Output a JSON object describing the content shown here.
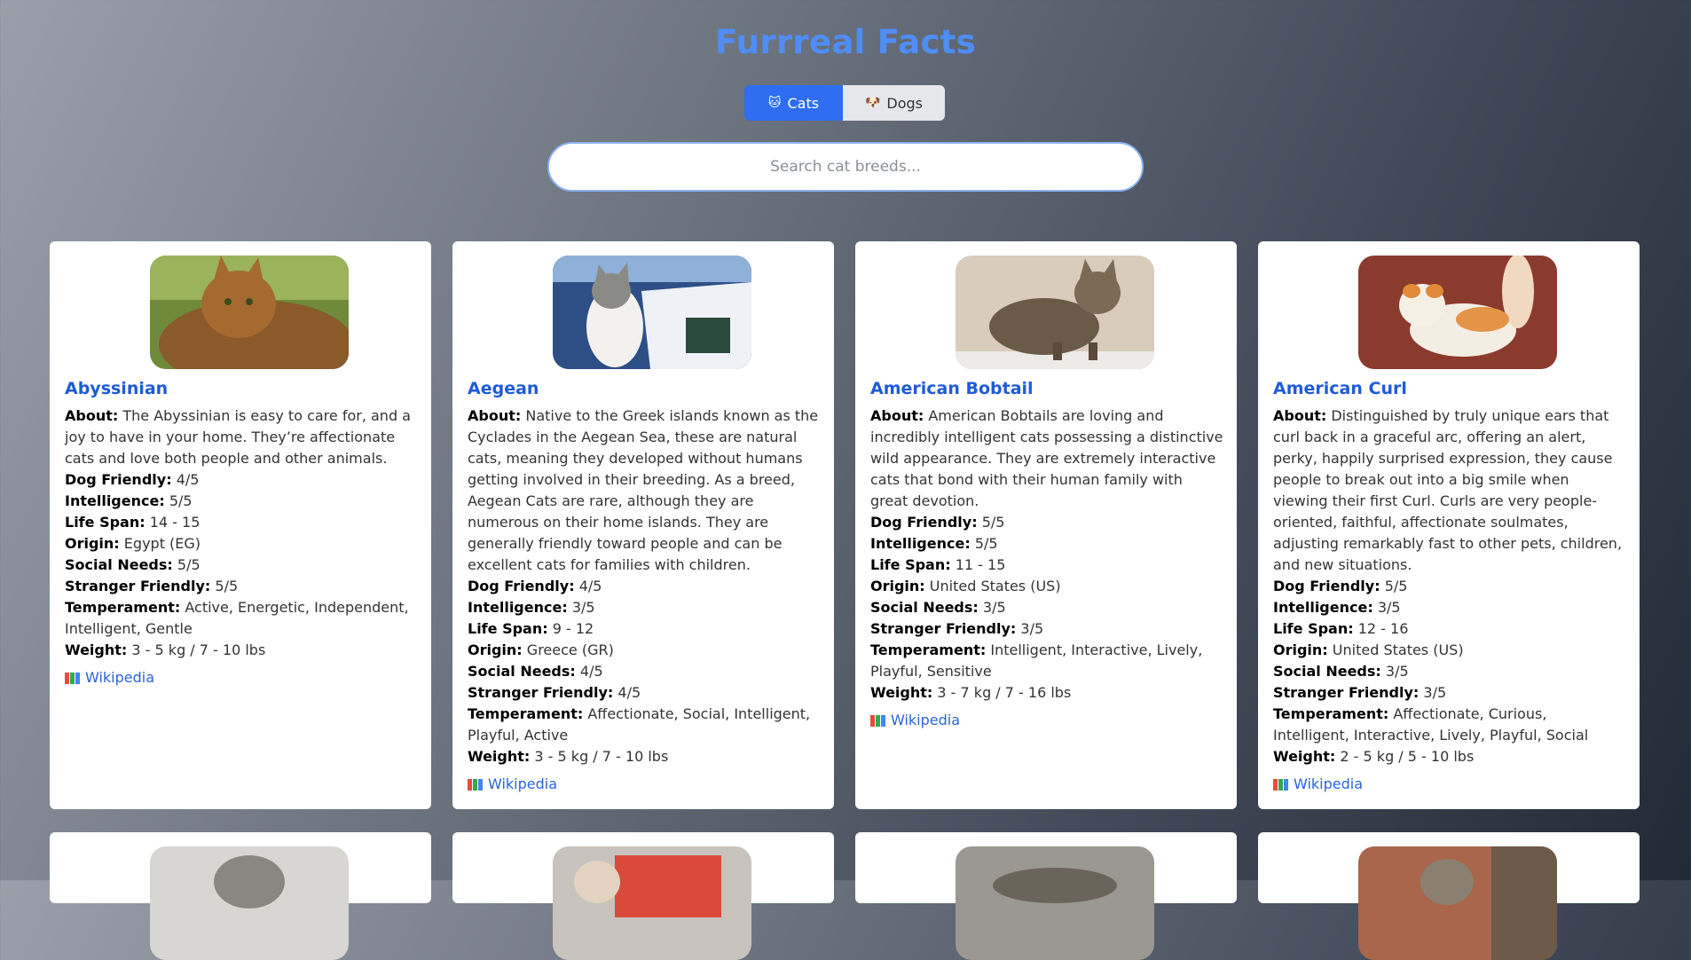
{
  "app": {
    "title": "Furrreal Facts",
    "tabs": [
      {
        "label": "Cats",
        "icon": "cat-face-icon",
        "active": true
      },
      {
        "label": "Dogs",
        "icon": "dog-face-icon",
        "active": false
      }
    ],
    "search": {
      "placeholder": "Search cat breeds...",
      "value": ""
    }
  },
  "labels": {
    "about": "About:",
    "dog_friendly": "Dog Friendly:",
    "intelligence": "Intelligence:",
    "life_span": "Life Span:",
    "origin": "Origin:",
    "social_needs": "Social Needs:",
    "stranger_friendly": "Stranger Friendly:",
    "temperament": "Temperament:",
    "weight": "Weight:",
    "wiki_link": "Wikipedia"
  },
  "breeds": [
    {
      "name": "Abyssinian",
      "about": "The Abyssinian is easy to care for, and a joy to have in your home. They’re affectionate cats and love both people and other animals.",
      "dog_friendly": "4/5",
      "intelligence": "5/5",
      "life_span": "14 - 15",
      "origin": "Egypt (EG)",
      "social_needs": "5/5",
      "stranger_friendly": "5/5",
      "temperament": "Active, Energetic, Independent, Intelligent, Gentle",
      "weight": "3 - 5 kg / 7 - 10 lbs"
    },
    {
      "name": "Aegean",
      "about": "Native to the Greek islands known as the Cyclades in the Aegean Sea, these are natural cats, meaning they developed without humans getting involved in their breeding. As a breed, Aegean Cats are rare, although they are numerous on their home islands. They are generally friendly toward people and can be excellent cats for families with children.",
      "dog_friendly": "4/5",
      "intelligence": "3/5",
      "life_span": "9 - 12",
      "origin": "Greece (GR)",
      "social_needs": "4/5",
      "stranger_friendly": "4/5",
      "temperament": "Affectionate, Social, Intelligent, Playful, Active",
      "weight": "3 - 5 kg / 7 - 10 lbs"
    },
    {
      "name": "American Bobtail",
      "about": "American Bobtails are loving and incredibly intelligent cats possessing a distinctive wild appearance. They are extremely interactive cats that bond with their human family with great devotion.",
      "dog_friendly": "5/5",
      "intelligence": "5/5",
      "life_span": "11 - 15",
      "origin": "United States (US)",
      "social_needs": "3/5",
      "stranger_friendly": "3/5",
      "temperament": "Intelligent, Interactive, Lively, Playful, Sensitive",
      "weight": "3 - 7 kg / 7 - 16 lbs"
    },
    {
      "name": "American Curl",
      "about": "Distinguished by truly unique ears that curl back in a graceful arc, offering an alert, perky, happily surprised expression, they cause people to break out into a big smile when viewing their first Curl. Curls are very people-oriented, faithful, affectionate soulmates, adjusting remarkably fast to other pets, children, and new situations.",
      "dog_friendly": "5/5",
      "intelligence": "3/5",
      "life_span": "12 - 16",
      "origin": "United States (US)",
      "social_needs": "3/5",
      "stranger_friendly": "3/5",
      "temperament": "Affectionate, Curious, Intelligent, Interactive, Lively, Playful, Social",
      "weight": "2 - 5 kg / 5 - 10 lbs"
    }
  ],
  "colors": {
    "accent": "#2f6df2",
    "title": "#4f8df7",
    "link": "#2a64d8",
    "breed_name": "#1f5bd8"
  }
}
